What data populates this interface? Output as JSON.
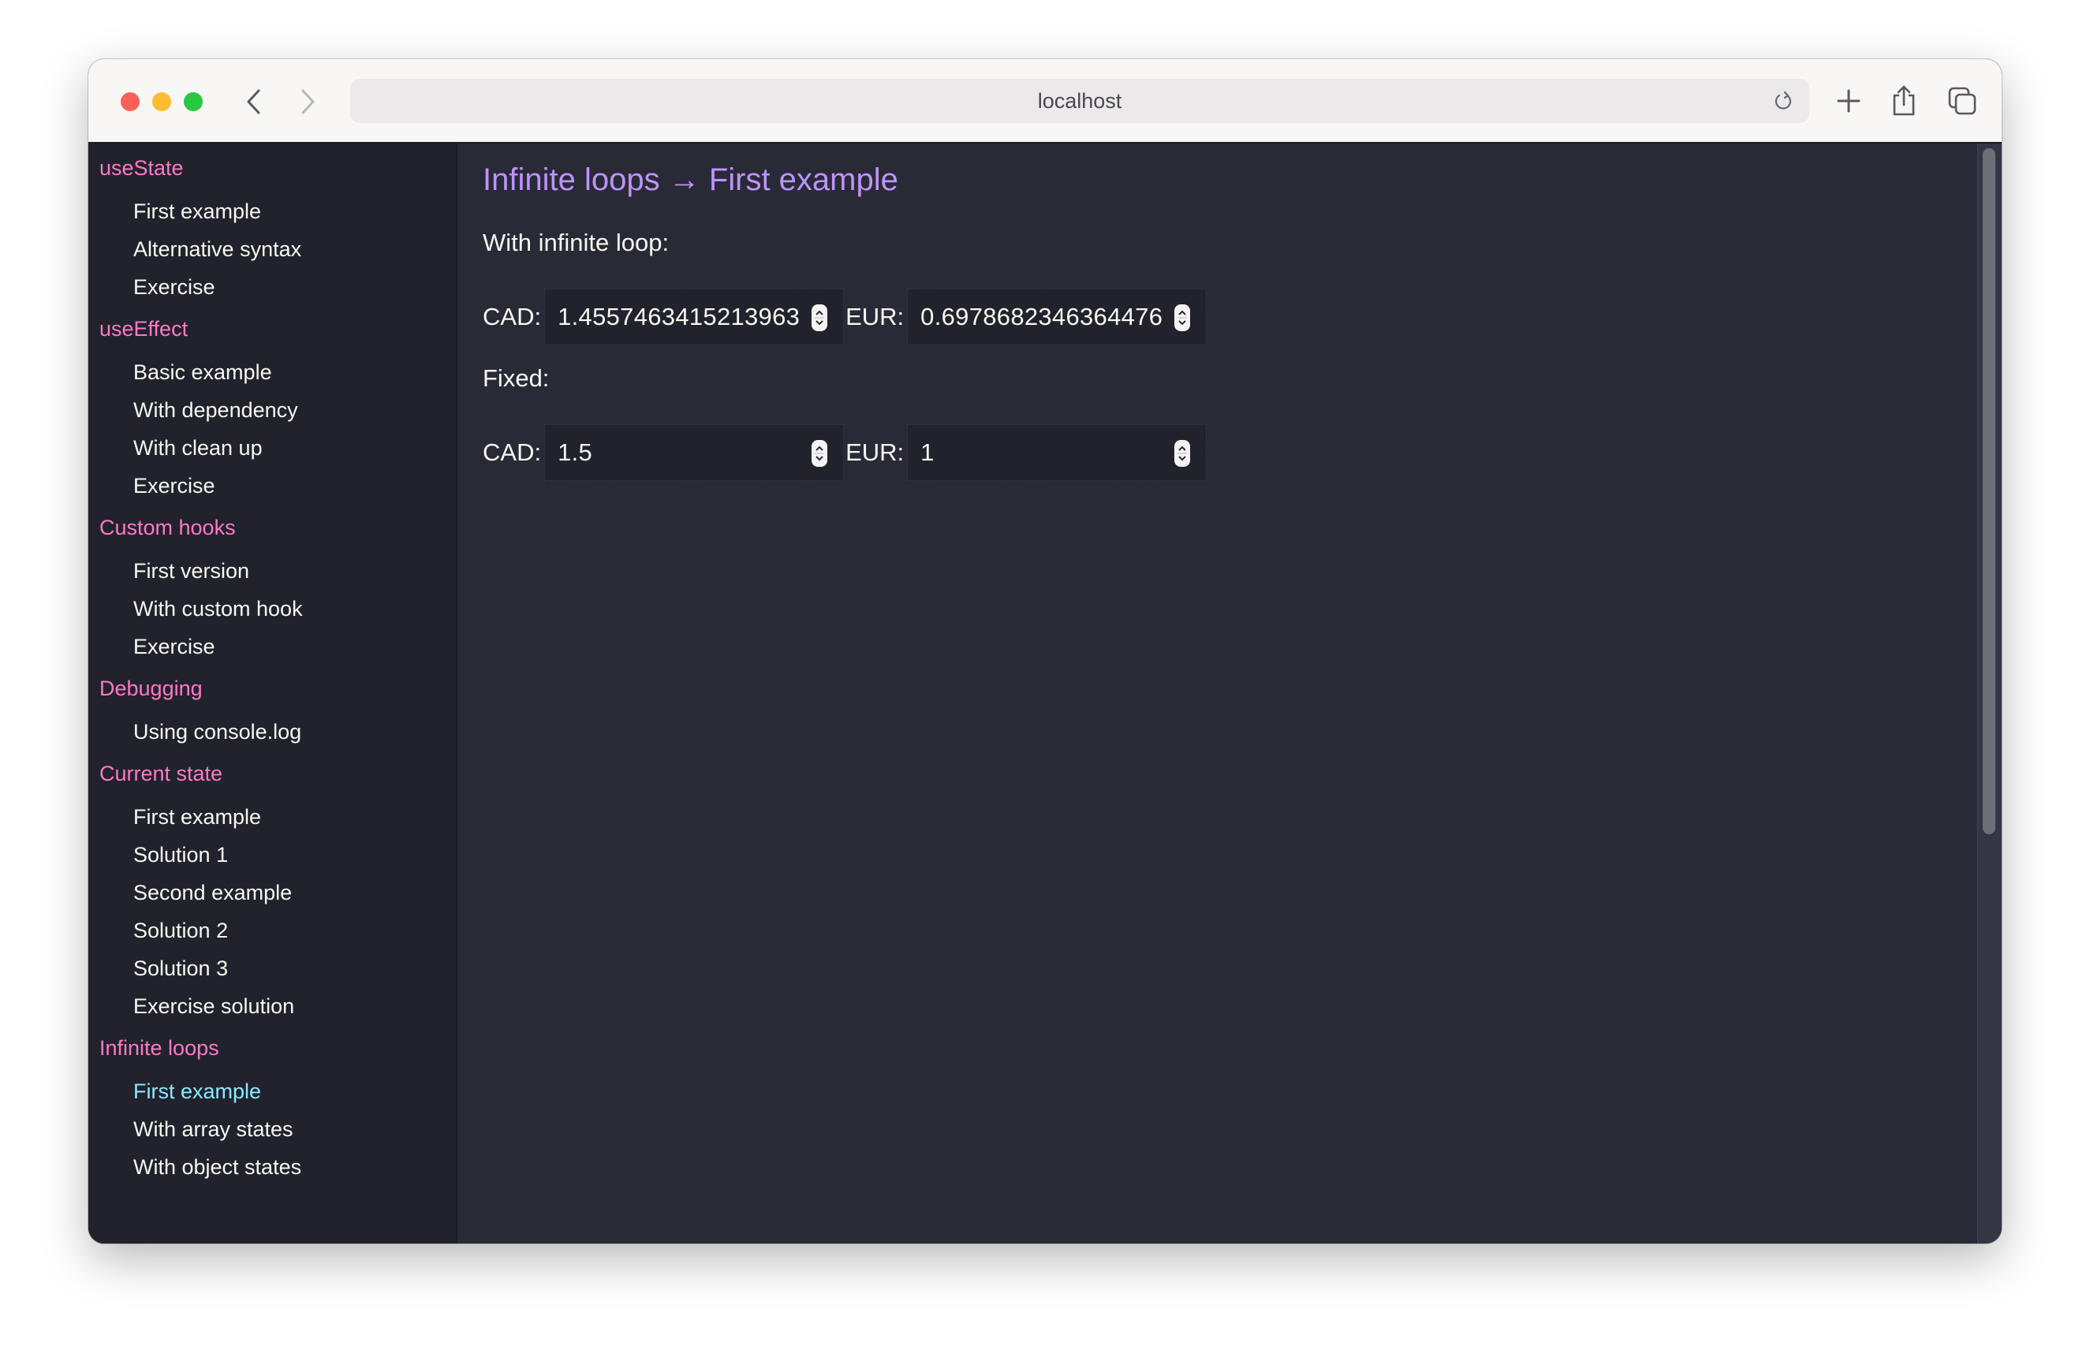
{
  "browser": {
    "url": "localhost",
    "icons": {
      "close": "close-traffic-light",
      "minimize": "minimize-traffic-light",
      "maximize": "maximize-traffic-light",
      "back": "chevron-left-icon",
      "forward": "chevron-right-icon",
      "reload": "reload-icon",
      "new_tab": "plus-icon",
      "share": "share-icon",
      "tabs": "tab-overview-icon"
    }
  },
  "sidebar": {
    "sections": [
      {
        "title": "useState",
        "items": [
          "First example",
          "Alternative syntax",
          "Exercise"
        ]
      },
      {
        "title": "useEffect",
        "items": [
          "Basic example",
          "With dependency",
          "With clean up",
          "Exercise"
        ]
      },
      {
        "title": "Custom hooks",
        "items": [
          "First version",
          "With custom hook",
          "Exercise"
        ]
      },
      {
        "title": "Debugging",
        "items": [
          "Using console.log"
        ]
      },
      {
        "title": "Current state",
        "items": [
          "First example",
          "Solution 1",
          "Second example",
          "Solution 2",
          "Solution 3",
          "Exercise solution"
        ]
      },
      {
        "title": "Infinite loops",
        "items": [
          "First example",
          "With array states",
          "With object states"
        ]
      }
    ],
    "active": {
      "section": "Infinite loops",
      "item": "First example"
    }
  },
  "main": {
    "title": "Infinite loops → First example",
    "infinite": {
      "heading": "With infinite loop:",
      "cad_label": "CAD:",
      "cad_value": "1.4557463415213963",
      "eur_label": "EUR:",
      "eur_value": "0.6978682346364476"
    },
    "fixed": {
      "heading": "Fixed:",
      "cad_label": "CAD:",
      "cad_value": "1.5",
      "eur_label": "EUR:",
      "eur_value": "1"
    }
  },
  "colors": {
    "section_title": "#ff79c6",
    "active_item": "#8be9fd",
    "page_title": "#bd93f9",
    "background": "#282a36",
    "sidebar_background": "#21222c"
  }
}
